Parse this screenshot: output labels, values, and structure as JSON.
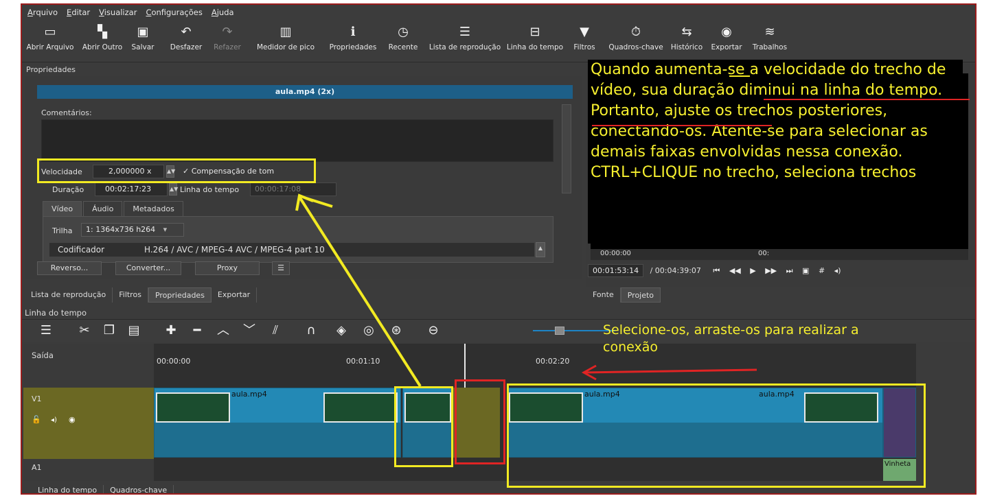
{
  "menubar": [
    "Arquivo",
    "Editar",
    "Visualizar",
    "Configurações",
    "Ajuda"
  ],
  "toolbar": {
    "items": [
      {
        "label": "Abrir Arquivo",
        "icon": "folder-open-icon",
        "glyph": "▭"
      },
      {
        "label": "Abrir Outro",
        "icon": "open-other-icon",
        "glyph": "▚"
      },
      {
        "label": "Salvar",
        "icon": "save-icon",
        "glyph": "▣"
      },
      {
        "label": "Desfazer",
        "icon": "undo-icon",
        "glyph": "↶"
      },
      {
        "label": "Refazer",
        "icon": "redo-icon",
        "glyph": "↷"
      },
      {
        "label": "Medidor de pico",
        "icon": "peak-meter-icon",
        "glyph": "▥"
      },
      {
        "label": "Propriedades",
        "icon": "info-icon",
        "glyph": "ℹ"
      },
      {
        "label": "Recente",
        "icon": "clock-icon",
        "glyph": "◷"
      },
      {
        "label": "Lista de reprodução",
        "icon": "playlist-icon",
        "glyph": "☰"
      },
      {
        "label": "Linha do tempo",
        "icon": "timeline-icon",
        "glyph": "⊟"
      },
      {
        "label": "Filtros",
        "icon": "filter-icon",
        "glyph": "▼"
      },
      {
        "label": "Quadros-chave",
        "icon": "stopwatch-icon",
        "glyph": "⏱"
      },
      {
        "label": "Histórico",
        "icon": "history-icon",
        "glyph": "⇆"
      },
      {
        "label": "Exportar",
        "icon": "export-disc-icon",
        "glyph": "◉"
      },
      {
        "label": "Trabalhos",
        "icon": "jobs-stack-icon",
        "glyph": "≋"
      }
    ]
  },
  "properties": {
    "title": "Propriedades",
    "clip_name": "aula.mp4 (2x)",
    "comments_label": "Comentários:",
    "speed_label": "Velocidade",
    "speed_value": "2,000000 x",
    "pitch_check": "✓",
    "pitch_label": "Compensação de tom",
    "duration_label": "Duração",
    "duration_value": "00:02:17:23",
    "timeline_label": "Linha do tempo",
    "timeline_value": "00:00:17:08",
    "tabs": [
      "Vídeo",
      "Áudio",
      "Metadados"
    ],
    "track_label": "Trilha",
    "track_value": "1: 1364x736 h264",
    "codec_label": "Codificador",
    "codec_value": "H.264 / AVC / MPEG-4 AVC / MPEG-4 part 10",
    "buttons": {
      "reverse": "Reverso...",
      "convert": "Converter...",
      "proxy": "Proxy",
      "menu": "☰"
    }
  },
  "panel_tabs": [
    "Lista de reprodução",
    "Filtros",
    "Propriedades",
    "Exportar"
  ],
  "player": {
    "tabs": [
      "Fonte",
      "Projeto"
    ],
    "ruler_a": "00:00:00",
    "ruler_b": "00:",
    "timecode": "00:01:53:14",
    "total": "/ 00:04:39:07"
  },
  "timeline": {
    "title": "Linha do tempo",
    "output_label": "Saída",
    "v1_label": "V1",
    "a1_label": "A1",
    "ticks": [
      "00:00:00",
      "00:01:10",
      "00:02:20"
    ],
    "clip_label": "aula.mp4",
    "vinheta_label": "Vinheta",
    "bottom_tabs": [
      "Linha do tempo",
      "Quadros-chave"
    ]
  },
  "annotations": {
    "main_note": "Quando aumenta-se a velocidade do trecho de vídeo, sua duração diminui na linha do tempo. Portanto, ajuste os trechos posteriores, conectando-os. Atente-se para selecionar as demais faixas envolvidas nessa conexão. CTRL+CLIQUE no trecho, seleciona trechos",
    "second_note": "Selecione-os, arraste-os para realizar a conexão",
    "yellow": "#f2ea22",
    "red": "#e02424"
  }
}
